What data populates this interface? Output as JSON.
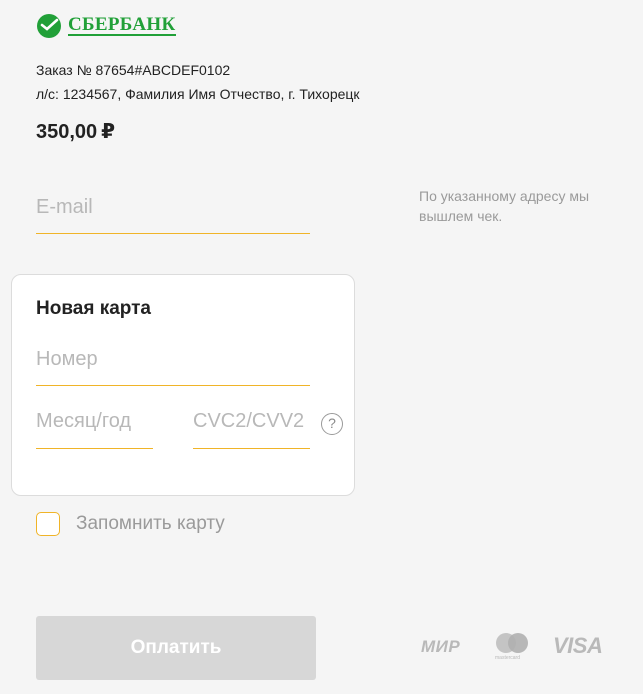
{
  "brand": {
    "name": "СБЕРБАНК",
    "color": "#21a038",
    "icon": "sberbank-logo-icon"
  },
  "order": {
    "line1": "Заказ № 87654#ABCDEF0102",
    "line2": "л/с: 1234567, Фамилия Имя Отчество, г. Тихорецк",
    "amount": "350,00",
    "currency": "₽"
  },
  "email": {
    "placeholder": "E-mail",
    "value": "",
    "note": "По указанному адресу мы вышлем чек."
  },
  "card": {
    "title": "Новая карта",
    "number_placeholder": "Номер",
    "expiry_placeholder": "Месяц/год",
    "cvc_placeholder": "CVC2/CVV2",
    "help_symbol": "?"
  },
  "remember": {
    "label": "Запомнить карту",
    "checked": false
  },
  "pay_button": {
    "label": "Оплатить",
    "enabled": false
  },
  "payment_systems": {
    "mir": "МИР",
    "mastercard": "mastercard",
    "visa": "VISA"
  },
  "colors": {
    "accent": "#f0b428",
    "brand": "#21a038",
    "disabled": "#d7d7d7",
    "muted": "#9a9a9a"
  }
}
